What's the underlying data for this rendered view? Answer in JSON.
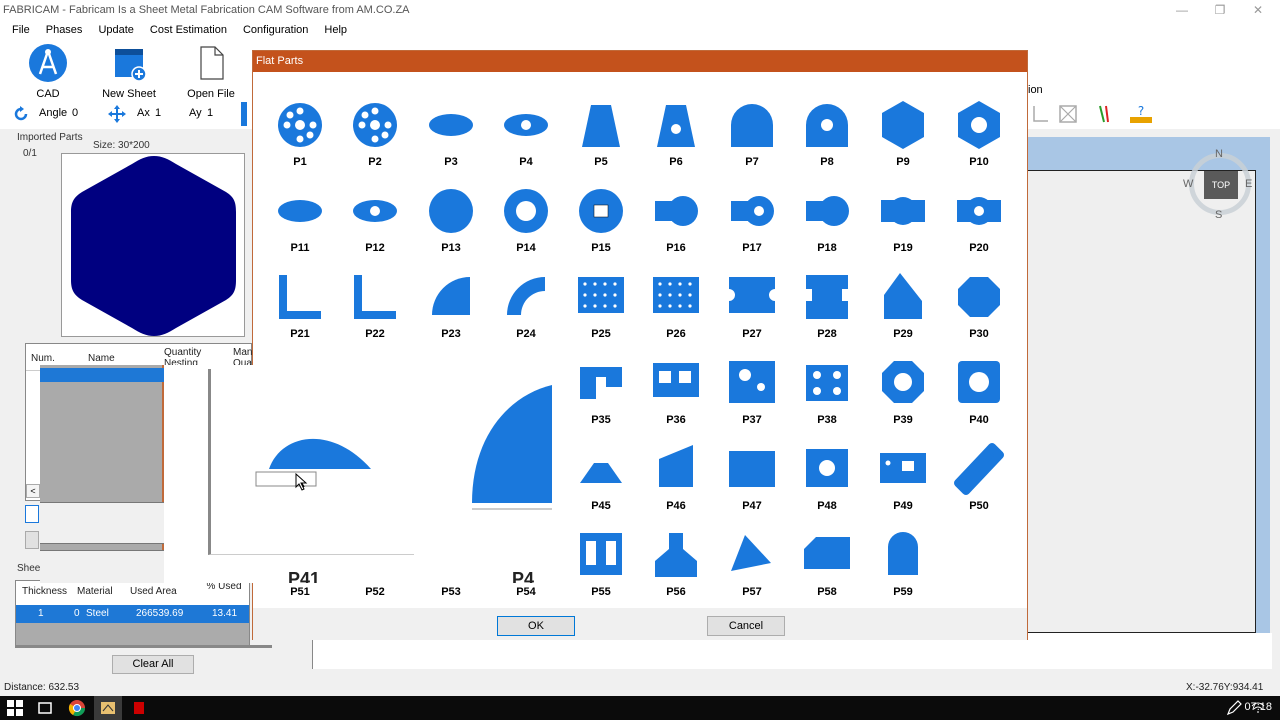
{
  "window": {
    "title": "FABRICAM - Fabricam Is a Sheet Metal Fabrication CAM Software from AM.CO.ZA"
  },
  "menu": [
    "File",
    "Phases",
    "Update",
    "Cost Estimation",
    "Configuration",
    "Help"
  ],
  "ribbon": {
    "cad": "CAD",
    "new_sheet": "New Sheet",
    "open_file": "Open File",
    "right_label": "ion"
  },
  "toolrow": {
    "angle_label": "Angle",
    "angle_value": "0",
    "ax_label": "Ax",
    "ax_value": "1",
    "ay_label": "Ay",
    "ay_value": "1"
  },
  "left": {
    "imported_parts": "Imported Parts",
    "count": "0/1",
    "size": "Size: 30*200",
    "grid_headers": [
      "Num.",
      "Name",
      "Quantity Nesting",
      "Man Quan"
    ],
    "sheets_label": "Sheet",
    "sheet_headers": [
      "Thickness",
      "Material",
      "Used Area",
      "% Used"
    ],
    "sheet_row": [
      "1",
      "0",
      "Steel",
      "266539.69",
      "13.41"
    ],
    "clear_all": "Clear All"
  },
  "compass": {
    "n": "N",
    "s": "S",
    "e": "E",
    "w": "W",
    "top": "TOP"
  },
  "dialog": {
    "title": "Flat Parts",
    "ok": "OK",
    "cancel": "Cancel",
    "parts": [
      "P1",
      "P2",
      "P3",
      "P4",
      "P5",
      "P6",
      "P7",
      "P8",
      "P9",
      "P10",
      "P11",
      "P12",
      "P13",
      "P14",
      "P15",
      "P16",
      "P17",
      "P18",
      "P19",
      "P20",
      "P21",
      "P22",
      "P23",
      "P24",
      "P25",
      "P26",
      "P27",
      "P28",
      "P29",
      "P30",
      "P35",
      "P36",
      "P37",
      "P38",
      "P39",
      "P40",
      "P45",
      "P46",
      "P47",
      "P48",
      "P49",
      "P50",
      "P51",
      "P52",
      "P53",
      "P54",
      "P55",
      "P56",
      "P57",
      "P58",
      "P59"
    ]
  },
  "zoom_overlay": {
    "label_left": "P41",
    "label_right": "P4"
  },
  "status": {
    "distance": "Distance: 632.53",
    "coords": "X:-32.76Y:934.41"
  },
  "taskbar": {
    "time": "07:18"
  },
  "colors": {
    "part_blue": "#1a78dc",
    "hex_navy": "#000080",
    "dialog_title": "#c4521c",
    "selection": "#1e78d6"
  }
}
